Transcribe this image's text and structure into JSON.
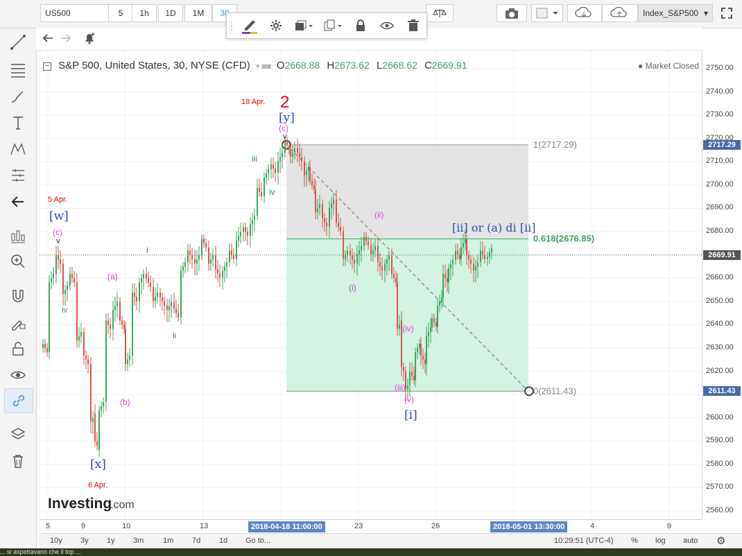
{
  "toolbar": {
    "symbol": "US500",
    "resolutions": [
      "5",
      "1h",
      "1D",
      "1M",
      "30"
    ],
    "index_name": "Index_S&P500"
  },
  "legend": {
    "title": "S&P 500, United States, 30, NYSE (CFD)",
    "open_label": "O",
    "open": "2668.88",
    "high_label": "H",
    "high": "2673.62",
    "low_label": "L",
    "low": "2668.62",
    "close_label": "C",
    "close": "2669.91",
    "status": "Market Closed"
  },
  "price_axis": {
    "ticks": [
      "2750.00",
      "2740.00",
      "2730.00",
      "2720.00",
      "2710.00",
      "2700.00",
      "2690.00",
      "2680.00",
      "2670.00",
      "2660.00",
      "2650.00",
      "2640.00",
      "2630.00",
      "2620.00",
      "2610.00",
      "2600.00",
      "2590.00",
      "2580.00",
      "2570.00",
      "2560.00"
    ],
    "label_top": "2717.29",
    "label_last": "2669.91",
    "label_bottom": "2611.43"
  },
  "time_axis": {
    "ticks": [
      "5",
      "9",
      "10",
      "13",
      "23",
      "26",
      "4",
      "9"
    ],
    "label_start": "2018-04-18 11:00:00",
    "label_end": "2018-05-01 13:30:00"
  },
  "fib": {
    "level1": "1(2717.29)",
    "level618": "0.618(2676.85)",
    "level0": "0(2611.43)"
  },
  "annotations": {
    "apr5": "5 Apr.",
    "apr6": "6 Apr.",
    "apr18": "18 Apr.",
    "wave2": "2",
    "w": "[w]",
    "x": "[x]",
    "y": "[y]",
    "c1": "(c)",
    "c2": "(c)",
    "v_small": "v",
    "v_small2": "v",
    "iv1": "iv",
    "iv2": "iv",
    "i1": "i",
    "ii1": "ii",
    "iii1": "iii",
    "a": "(a)",
    "b": "(b)",
    "wi": "(i)",
    "wii": "(ii)",
    "wiii": "(iii)",
    "wiv": "(iv)",
    "wv": "(v)",
    "big_i": "[i]",
    "scenario": "[ii] or (a) di [ii]"
  },
  "bottom": {
    "ranges": [
      "10y",
      "3y",
      "1y",
      "3m",
      "1m",
      "7d",
      "1d"
    ],
    "goto": "Go to...",
    "clock": "10:29:51 (UTC-4)",
    "pct": "%",
    "log": "log",
    "auto": "auto"
  },
  "watermark": "Investing",
  "watermark_suffix": ".com",
  "footer_text": "... si aspettavano che il top ...",
  "chart_data": {
    "type": "candlestick",
    "ylim": [
      2555,
      2755
    ],
    "fib_levels": [
      2717.29,
      2676.85,
      2611.43
    ],
    "last_price": 2669.91,
    "colors": {
      "up": "#3aa45e",
      "down": "#d9534f",
      "fib_top": "#d9d9d9",
      "fib_bottom": "#c8f0dc"
    }
  }
}
